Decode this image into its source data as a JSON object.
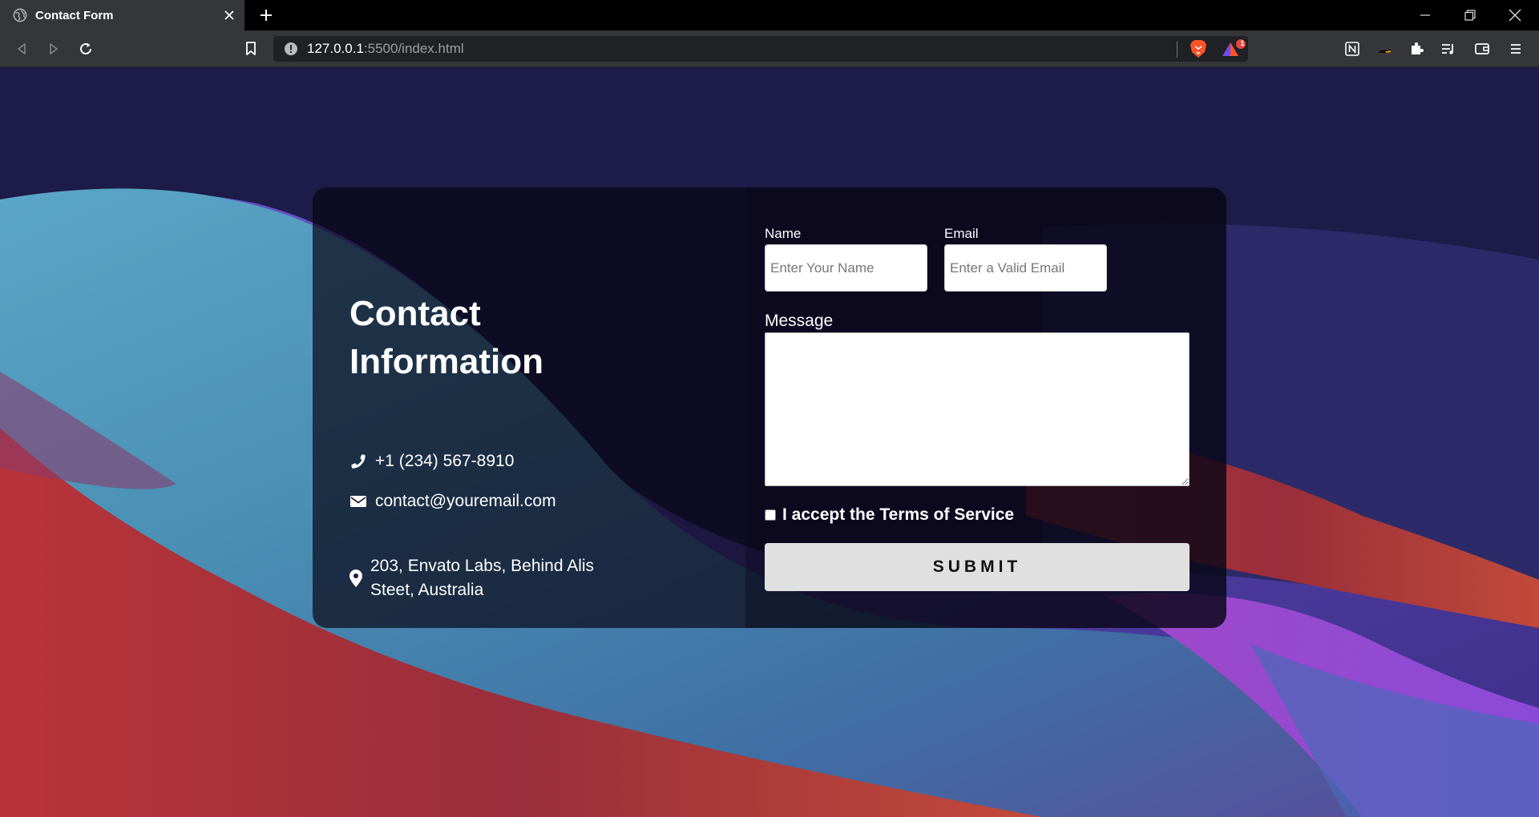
{
  "browser": {
    "tab_title": "Contact Form",
    "url_host": "127.0.0.1",
    "url_rest": ":5500/index.html",
    "rewards_badge": "1"
  },
  "contact": {
    "title": "Contact Information",
    "phone": "+1 (234) 567-8910",
    "email": "contact@youremail.com",
    "address": "203, Envato Labs, Behind Alis Steet, Australia"
  },
  "form": {
    "name_label": "Name",
    "name_placeholder": "Enter Your Name",
    "email_label": "Email",
    "email_placeholder": "Enter a Valid Email",
    "message_label": "Message",
    "terms_label": "I accept the Terms of Service",
    "submit_label": "SUBMIT"
  },
  "icons": {
    "tab": "globe-icon",
    "phone": "phone-icon",
    "email": "envelope-icon",
    "address": "map-pin-icon"
  },
  "colors": {
    "page_bg": "#1d1a45",
    "submit_bg": "#e0e0e0",
    "rewards_badge": "#e8463a"
  }
}
